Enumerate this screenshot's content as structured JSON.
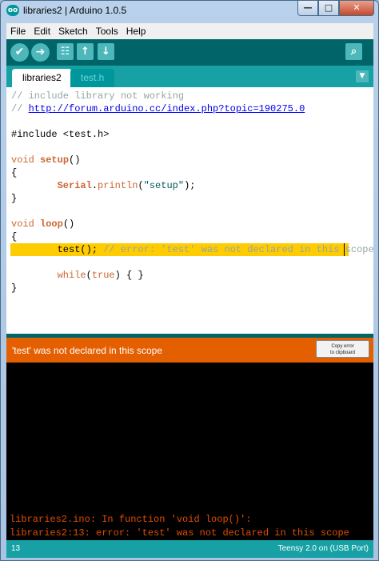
{
  "window": {
    "title": "libraries2 | Arduino 1.0.5",
    "icon_label": "oo",
    "minimize_glyph": "—",
    "maximize_glyph": "□",
    "close_glyph": "✕"
  },
  "menu": [
    "File",
    "Edit",
    "Sketch",
    "Tools",
    "Help"
  ],
  "toolbar": {
    "verify_icon": "✔",
    "upload_icon": "➔",
    "new_icon": "☷",
    "open_icon": "↑",
    "save_icon": "↓",
    "serial_monitor_icon": "⌕"
  },
  "tabs": [
    {
      "label": "libraries2",
      "active": true
    },
    {
      "label": "test.h",
      "active": false
    }
  ],
  "tab_menu_icon": "▼",
  "code": {
    "l1": "// include library not working",
    "l2_prefix": "// ",
    "l2_url": "http://forum.arduino.cc/index.php?topic=190275.0",
    "l3": "#include <test.h>",
    "l4_kw": "void",
    "l4_fn": "setup",
    "l4_rest": "()",
    "l5": "{",
    "l6_indent": "        ",
    "l6_obj": "Serial",
    "l6_dot": ".",
    "l6_method": "println",
    "l6_open": "(",
    "l6_str": "\"setup\"",
    "l6_close": ");",
    "l7": "}",
    "l8_kw": "void",
    "l8_fn": "loop",
    "l8_rest": "()",
    "l9": "{",
    "l10_code": "        test(); ",
    "l10_comment": "// error: 'test' was not declared in this scope",
    "l11_indent": "        ",
    "l11_kw": "while",
    "l11_open": "(",
    "l11_val": "true",
    "l11_close": ") { }",
    "l12": "}"
  },
  "status": {
    "message": "'test' was not declared in this scope",
    "copy_button_line1": "Copy error",
    "copy_button_line2": "to clipboard"
  },
  "console": [
    "libraries2.ino: In function 'void loop()':",
    "libraries2:13: error: 'test' was not declared in this scope"
  ],
  "footer": {
    "line_number": "13",
    "board": "Teensy 2.0 on (USB Port)"
  },
  "colors": {
    "toolbar": "#006468",
    "tabbar": "#17a1a5",
    "highlight": "#ffcc00",
    "error_bar": "#e45f00",
    "console_text": "#e34c00"
  }
}
